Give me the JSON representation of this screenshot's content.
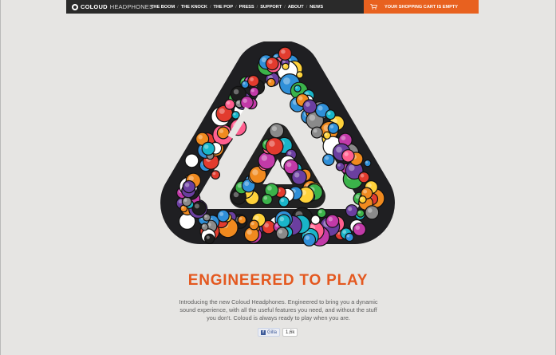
{
  "header": {
    "logo_bold": "COLOUD",
    "logo_light": "HEADPHONES",
    "nav": [
      {
        "label": "THE BOOM"
      },
      {
        "label": "THE KNOCK"
      },
      {
        "label": "THE POP"
      },
      {
        "label": "PRESS"
      },
      {
        "label": "SUPPORT"
      },
      {
        "label": "ABOUT"
      },
      {
        "label": "NEWS"
      }
    ],
    "nav_separator": "/",
    "cart_label": "YOUR SHOPPING CART IS EMPTY"
  },
  "main": {
    "headline": "ENGINEERED TO PLAY",
    "intro": "Introducing the new Coloud Headphones. Engineered to bring you a dynamic sound experience, with all the useful features you need, and without the stuff you don't. Coloud is always ready to play when you are.",
    "like_label": "Gilla",
    "like_count": "1,6k"
  },
  "colors": {
    "accent": "#e8611f",
    "headline": "#e4581f",
    "topbar": "#2a2a2a",
    "background": "#e6e5e3"
  },
  "icons": [
    "coloud-logo-icon",
    "shopping-cart-icon",
    "facebook-icon"
  ]
}
